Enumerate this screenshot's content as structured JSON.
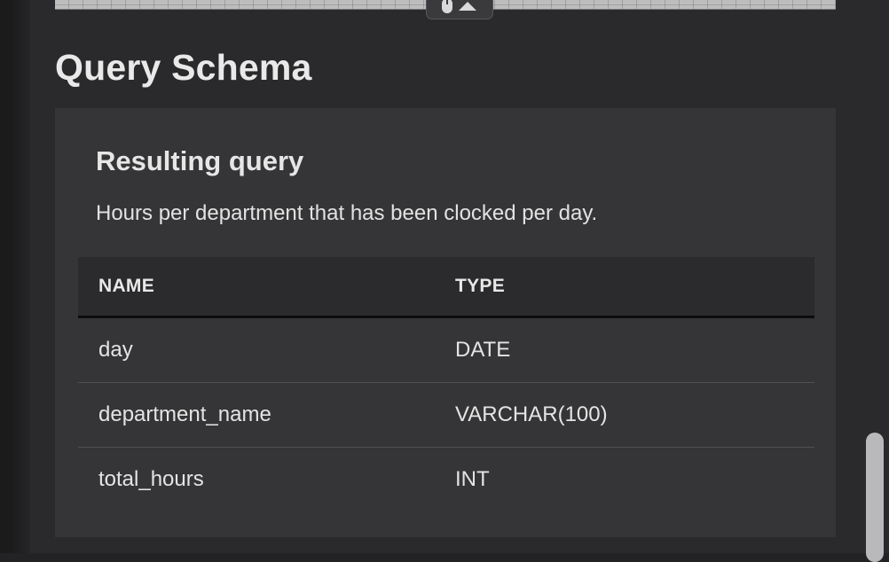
{
  "page": {
    "title": "Query Schema"
  },
  "result_card": {
    "heading": "Resulting query",
    "description": "Hours per department that has been clocked per day.",
    "table": {
      "columns": [
        "NAME",
        "TYPE"
      ],
      "rows": [
        {
          "name": "day",
          "type": "DATE"
        },
        {
          "name": "department_name",
          "type": "VARCHAR(100)"
        },
        {
          "name": "total_hours",
          "type": "INT"
        }
      ]
    }
  },
  "icons": {
    "collapse_handle": [
      "mouse-icon",
      "arrow-up-icon"
    ]
  },
  "colors": {
    "background": "#2a2a2c",
    "card": "#353537",
    "table_header": "#2b2b2d",
    "text": "#e6e6e6"
  }
}
